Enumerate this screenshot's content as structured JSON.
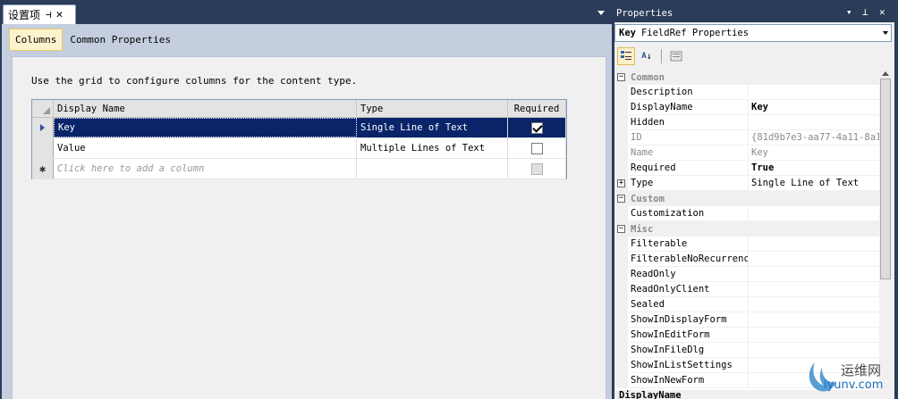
{
  "document": {
    "tab_title": "设置项",
    "pin_glyph": "⊣",
    "close_glyph": "✕",
    "designer_tabs": [
      {
        "label": "Columns",
        "active": true
      },
      {
        "label": "Common Properties",
        "active": false
      }
    ],
    "instructions": "Use the grid to configure columns for the content type.",
    "grid": {
      "headers": {
        "name": "Display Name",
        "type": "Type",
        "required": "Required"
      },
      "rows": [
        {
          "name": "Key",
          "type": "Single Line of Text",
          "required": true,
          "selected": true
        },
        {
          "name": "Value",
          "type": "Multiple Lines of Text",
          "required": false,
          "selected": false
        }
      ],
      "new_row_placeholder": "Click here to add a column"
    }
  },
  "properties": {
    "title": "Properties",
    "object_name": "Key",
    "object_type": "FieldRef Properties",
    "categories": {
      "common": "Common",
      "custom": "Custom",
      "misc": "Misc"
    },
    "rows": {
      "description": {
        "name": "Description",
        "value": ""
      },
      "displayname": {
        "name": "DisplayName",
        "value": "Key"
      },
      "hidden": {
        "name": "Hidden",
        "value": ""
      },
      "id": {
        "name": "ID",
        "value": "{81d9b7e3-aa77-4a11-8a1"
      },
      "name": {
        "name": "Name",
        "value": "Key"
      },
      "required": {
        "name": "Required",
        "value": "True"
      },
      "type": {
        "name": "Type",
        "value": "Single Line of Text"
      },
      "customization": {
        "name": "Customization",
        "value": ""
      },
      "filterable": {
        "name": "Filterable",
        "value": ""
      },
      "filterablenorecurrence": {
        "name": "FilterableNoRecurrence",
        "value": ""
      },
      "readonly": {
        "name": "ReadOnly",
        "value": ""
      },
      "readonlyclient": {
        "name": "ReadOnlyClient",
        "value": ""
      },
      "sealed": {
        "name": "Sealed",
        "value": ""
      },
      "showindisplayform": {
        "name": "ShowInDisplayForm",
        "value": ""
      },
      "showineditform": {
        "name": "ShowInEditForm",
        "value": ""
      },
      "showinfiledlg": {
        "name": "ShowInFileDlg",
        "value": ""
      },
      "showinlistsettings": {
        "name": "ShowInListSettings",
        "value": ""
      },
      "showinnewform": {
        "name": "ShowInNewForm",
        "value": ""
      }
    },
    "description_area": "DisplayName"
  },
  "watermark": {
    "cn": "运维网",
    "en": "iyunv.com"
  }
}
